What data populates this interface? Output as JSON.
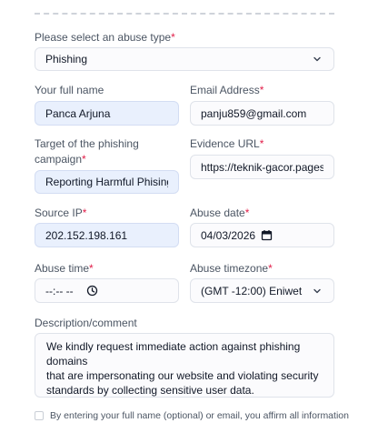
{
  "abuse_type": {
    "label": "Please select an abuse type",
    "required_mark": "*",
    "value": "Phishing",
    "icon": "chevron-down-icon"
  },
  "full_name": {
    "label": "Your full name",
    "value": "Panca Arjuna"
  },
  "email": {
    "label": "Email Address",
    "required_mark": "*",
    "value": "panju859@gmail.com"
  },
  "target": {
    "label_line1": "Target of the phishing",
    "label_line2": "campaign",
    "required_mark": "*",
    "value": "Reporting Harmful Phising l"
  },
  "evidence_url": {
    "label": "Evidence URL",
    "required_mark": "*",
    "value": "https://teknik-gacor.pages.c"
  },
  "source_ip": {
    "label": "Source IP",
    "required_mark": "*",
    "value": "202.152.198.161"
  },
  "abuse_date": {
    "label": "Abuse date",
    "required_mark": "*",
    "value": "04/03/2026",
    "icon": "calendar-icon"
  },
  "abuse_time": {
    "label": "Abuse time",
    "required_mark": "*",
    "value": "--:-- --",
    "icon": "clock-icon"
  },
  "abuse_timezone": {
    "label": "Abuse timezone",
    "required_mark": "*",
    "value": "(GMT -12:00) Eniwet",
    "icon": "chevron-down-icon"
  },
  "description": {
    "label": "Description/comment",
    "lines": [
      "We kindly request immediate action against phishing domains",
      "that are impersonating our website and violating security",
      "standards by collecting sensitive user data."
    ]
  },
  "consent": {
    "text": "By entering your full name (optional) or email, you affirm all information"
  },
  "colors": {
    "accent_fill": "#e9f0fd",
    "required": "#e11d48"
  }
}
